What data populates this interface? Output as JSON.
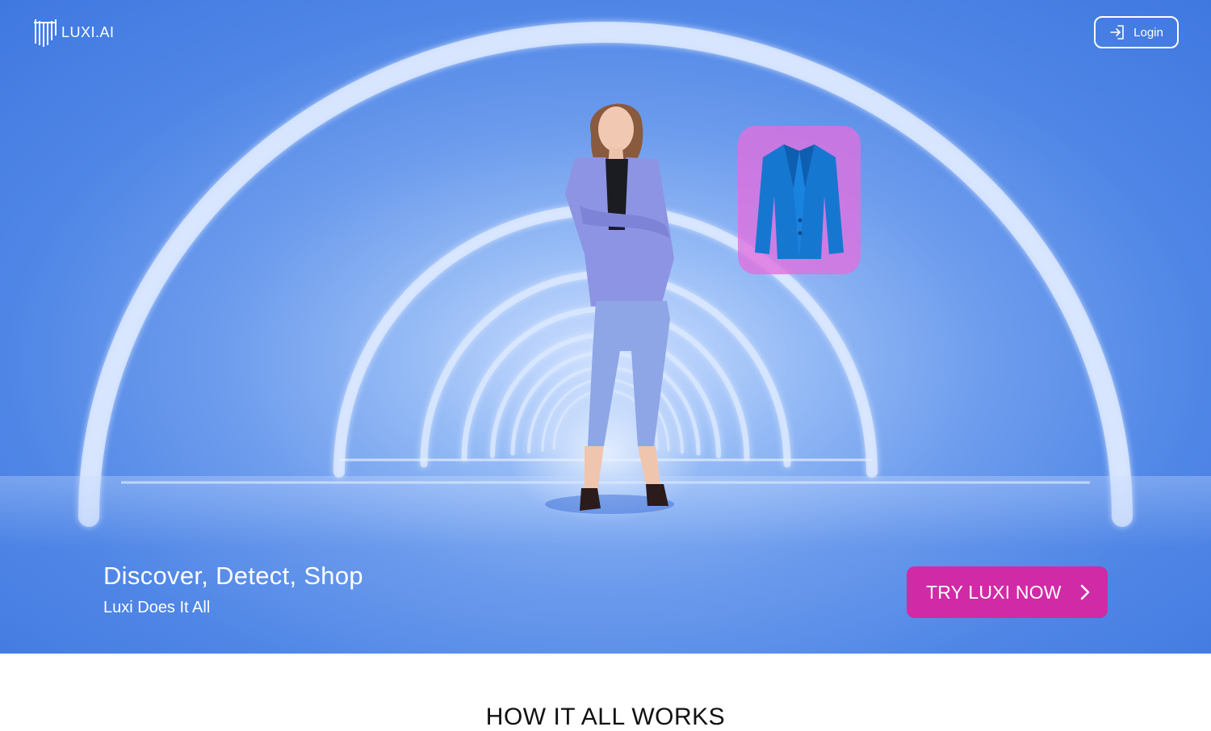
{
  "brand": {
    "name": "LUXI.AI",
    "icon": "luxi-logo-icon"
  },
  "header": {
    "login_label": "Login",
    "login_icon": "login-arrow-icon"
  },
  "hero": {
    "headline": "Discover, Detect, Shop",
    "subheadline": "Luxi Does It All",
    "cta_label": "TRY LUXI NOW",
    "cta_icon": "chevron-right-icon",
    "product_icon": "blazer-icon"
  },
  "section": {
    "title": "HOW IT ALL WORKS"
  },
  "colors": {
    "hero_bg": "#4f86e6",
    "cta": "#d12aa6",
    "product_card": "#e26ede",
    "text_light": "#ffffff",
    "text_dark": "#111111"
  }
}
